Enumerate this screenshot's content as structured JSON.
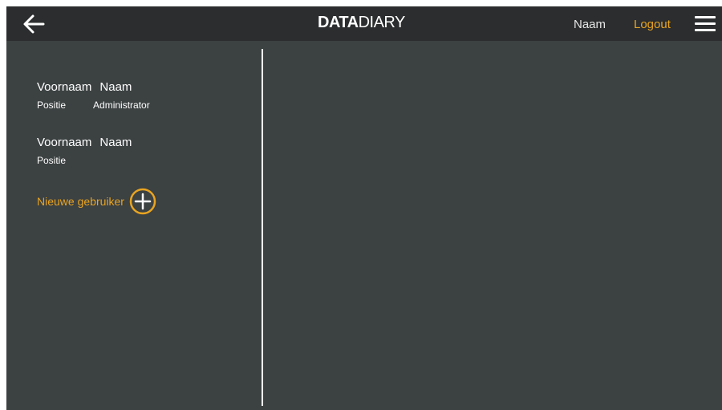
{
  "header": {
    "back_icon": "arrow-left-icon",
    "logo_bold": "DATA",
    "logo_light": "DIARY",
    "user_name": "Naam",
    "logout_label": "Logout",
    "menu_icon": "hamburger-menu-icon"
  },
  "sidebar": {
    "users": [
      {
        "first_name": "Voornaam",
        "last_name": "Naam",
        "position": "Positie",
        "role": "Administrator"
      },
      {
        "first_name": "Voornaam",
        "last_name": "Naam",
        "position": "Positie",
        "role": ""
      }
    ],
    "add_user_label": "Nieuwe gebruiker",
    "add_icon": "plus-circle-icon"
  },
  "colors": {
    "background": "#3c4142",
    "topbar": "#2b2d2e",
    "accent": "#e9a420",
    "text": "#ffffff"
  }
}
